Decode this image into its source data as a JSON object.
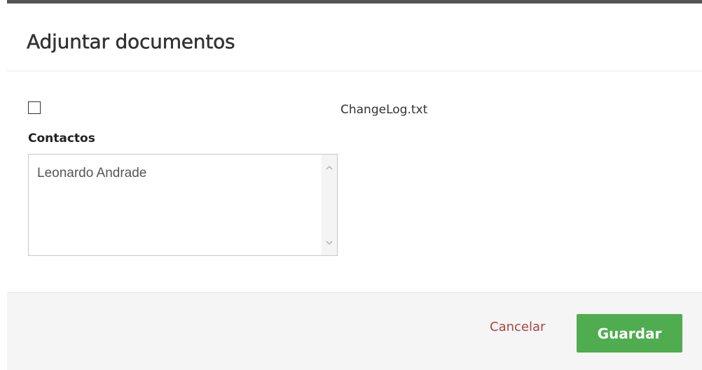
{
  "dialog": {
    "title": "Adjuntar documentos"
  },
  "attachment": {
    "checked": false,
    "filename": "ChangeLog.txt"
  },
  "contacts": {
    "label": "Contactos",
    "options": [
      "Leonardo Andrade"
    ]
  },
  "footer": {
    "cancel_label": "Cancelar",
    "save_label": "Guardar"
  },
  "colors": {
    "save_button": "#4fad4f",
    "cancel_link": "#a94442",
    "footer_bg": "#f5f5f5"
  },
  "icons": {
    "scroll_up": "chevron-up-icon",
    "scroll_down": "chevron-down-icon"
  }
}
